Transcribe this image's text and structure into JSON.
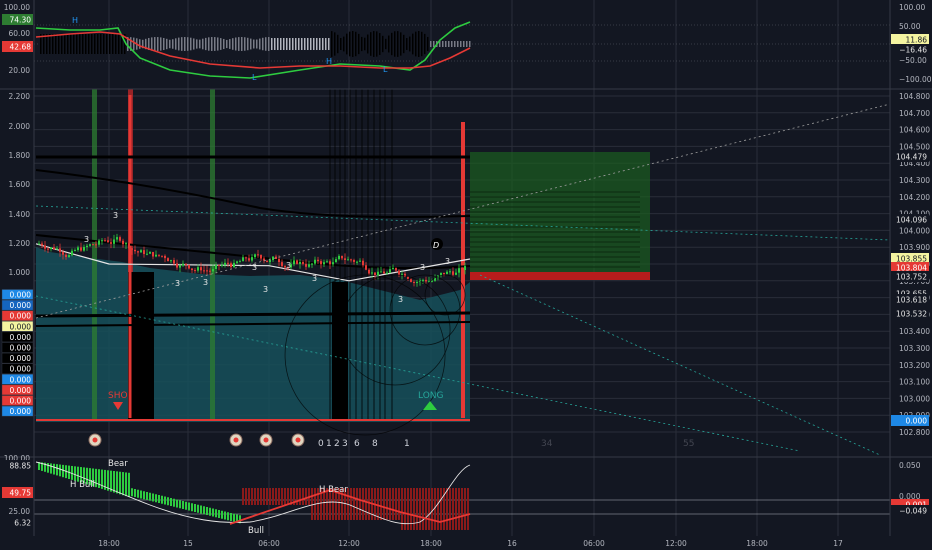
{
  "colors": {
    "background": "#131722",
    "grid": "#2a2e39",
    "axis_text": "#b2b5be",
    "bull": "#26a69a",
    "bull_bright": "#2ecc40",
    "bear": "#e53935",
    "separator": "#363a45",
    "profit_zone": "#1b5e20",
    "teal_fill": "#16505a"
  },
  "top_panel": {
    "left_ticks": [
      "100.00",
      "60.00",
      "20.00"
    ],
    "left_badges": [
      {
        "text": "74.30",
        "color": "#2e7d32"
      },
      {
        "text": "42.68",
        "color": "#e53935"
      }
    ],
    "right_ticks": [
      "100.00",
      "50.00",
      "−50.00",
      "−100.00"
    ],
    "right_badges": [
      {
        "text": "11.86",
        "color": "#f4f4a0",
        "text_color": "#131722"
      },
      {
        "text": "−16.46",
        "color": "#131722",
        "text_color": "#e6e6e6"
      }
    ],
    "labels": [
      "H",
      "H",
      "L",
      "L"
    ]
  },
  "main_panel": {
    "left_ticks": [
      "2.200",
      "2.000",
      "1.800",
      "1.600",
      "1.400",
      "1.200",
      "1.000"
    ],
    "left_badges": [
      {
        "text": "0.000",
        "color": "#1e88e5"
      },
      {
        "text": "0.000",
        "color": "#1565c0"
      },
      {
        "text": "0.000",
        "color": "#e53935"
      },
      {
        "text": "0.000",
        "color": "#f4f4a0"
      },
      {
        "text": "0.000",
        "color": "#000000"
      },
      {
        "text": "0.000",
        "color": "#000000"
      },
      {
        "text": "0.000",
        "color": "#000000"
      },
      {
        "text": "0.000",
        "color": "#000000"
      },
      {
        "text": "0.000",
        "color": "#1e88e5"
      },
      {
        "text": "0.000",
        "color": "#e53935"
      },
      {
        "text": "0.000",
        "color": "#e53935"
      },
      {
        "text": "0.000",
        "color": "#1e88e5"
      }
    ],
    "right_ticks": [
      "104.800",
      "104.700",
      "104.600",
      "104.500",
      "104.400",
      "104.300",
      "104.200",
      "104.100",
      "104.000",
      "103.900",
      "103.800",
      "103.700",
      "103.600",
      "103.500",
      "103.400",
      "103.300",
      "103.200",
      "103.100",
      "103.000",
      "102.900",
      "102.800"
    ],
    "right_badges": [
      {
        "text": "104.479",
        "color": "#131722",
        "text_color": "#e6e6e6"
      },
      {
        "text": "104.096",
        "color": "#131722",
        "text_color": "#e6e6e6"
      },
      {
        "text": "103.855",
        "color": "#f4f4a0",
        "text_color": "#131722"
      },
      {
        "text": "103.804",
        "color": "#e53935",
        "text_color": "#ffffff"
      },
      {
        "text": "103.752",
        "color": "#131722",
        "text_color": "#e6e6e6"
      },
      {
        "text": "103.655",
        "color": "#131722",
        "text_color": "#e6e6e6"
      },
      {
        "text": "103.618",
        "color": "#131722",
        "text_color": "#e6e6e6"
      },
      {
        "text": "103.532",
        "color": "#131722",
        "text_color": "#e6e6e6"
      },
      {
        "text": "0.000",
        "color": "#1e88e5",
        "text_color": "#ffffff"
      }
    ],
    "annotations": {
      "short_label": "SHO",
      "long_label": "LONG",
      "d_label": "D",
      "count_label": "3",
      "bottom_numbers": [
        "0",
        "1",
        "2",
        "3",
        "6",
        "8",
        "1"
      ],
      "fib_numbers": [
        "34",
        "55"
      ]
    }
  },
  "bottom_panel": {
    "left_ticks": [
      "100.00",
      "25.00"
    ],
    "left_badges": [
      {
        "text": "88.85",
        "color": "#131722",
        "text_color": "#e6e6e6"
      },
      {
        "text": "49.75",
        "color": "#e53935",
        "text_color": "#ffffff"
      },
      {
        "text": "6.32",
        "color": "#131722",
        "text_color": "#e6e6e6"
      }
    ],
    "right_ticks": [
      "0.050",
      "0.000"
    ],
    "right_badges": [
      {
        "text": "0.001",
        "color": "#e53935",
        "text_color": "#ffffff"
      },
      {
        "text": "−0.049",
        "color": "#131722",
        "text_color": "#e6e6e6"
      }
    ],
    "labels": [
      "Bear",
      "H Bull",
      "H Bear",
      "Bull"
    ]
  },
  "time_axis": {
    "labels": [
      "18:00",
      "15",
      "06:00",
      "12:00",
      "18:00",
      "16",
      "06:00",
      "12:00",
      "18:00",
      "17"
    ]
  },
  "chart_data": {
    "type": "line",
    "ylim": [
      102.8,
      104.8
    ],
    "xlabel": "",
    "ylabel": "",
    "price_levels": [
      104.479,
      104.096,
      103.855,
      103.804,
      103.752,
      103.655,
      103.618,
      103.532
    ],
    "series": [
      {
        "x": [
          "18:00",
          "15",
          "06:00",
          "12:00",
          "18:00"
        ],
        "values": [
          103.92,
          103.8,
          103.79,
          103.7,
          103.83
        ]
      }
    ]
  }
}
